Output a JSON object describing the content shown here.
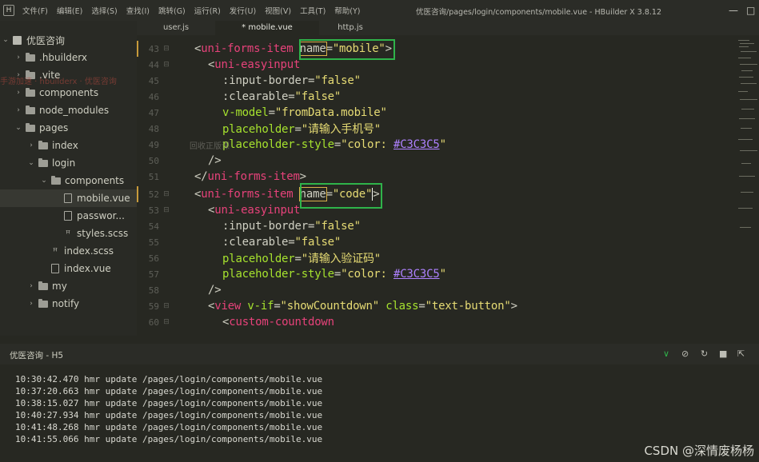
{
  "window": {
    "title": "优医咨询/pages/login/components/mobile.vue - HBuilder X 3.8.12",
    "logo": "H",
    "controls": {
      "minimize": "—",
      "maximize": "□"
    }
  },
  "menu": [
    "文件(F)",
    "编辑(E)",
    "选择(S)",
    "查找(I)",
    "跳转(G)",
    "运行(R)",
    "发行(U)",
    "视图(V)",
    "工具(T)",
    "帮助(Y)"
  ],
  "tabs": [
    {
      "label": "user.js"
    },
    {
      "label": "* mobile.vue",
      "active": true
    },
    {
      "label": "http.js"
    }
  ],
  "sidebar": {
    "project": "优医咨询",
    "watermark": "手游加速 · hbuilderx · 优医咨询",
    "items": [
      {
        "label": ".hbuilderx"
      },
      {
        "label": ".vite"
      },
      {
        "label": "components"
      },
      {
        "label": "node_modules"
      },
      {
        "label": "pages"
      },
      {
        "label": "index"
      },
      {
        "label": "login"
      },
      {
        "label": "components"
      },
      {
        "label": "mobile.vue",
        "selected": true
      },
      {
        "label": "passwor..."
      },
      {
        "label": "styles.scss"
      },
      {
        "label": "index.scss"
      },
      {
        "label": "index.vue"
      },
      {
        "label": "my"
      },
      {
        "label": "notify"
      }
    ],
    "tool_icons": [
      "files-icon",
      "binoculars-icon",
      "search-icon",
      "git-icon",
      "plugin-icon"
    ]
  },
  "editor": {
    "watermark": "回收正版课",
    "line_numbers": [
      "43",
      "44",
      "45",
      "46",
      "47",
      "48",
      "49",
      "50",
      "51",
      "52",
      "53",
      "54",
      "55",
      "56",
      "57",
      "58",
      "59",
      "60"
    ],
    "tokens": {
      "l43_open": "<",
      "l43_tag": "uni-forms-item",
      "l43_attr": "name",
      "l43_eq": "=",
      "l43_val": "\"mobile\"",
      "l43_close": ">",
      "l44_open": "<",
      "l44_tag": "uni-easyinput",
      "l45_attr": ":input-border",
      "l45_eq": "=",
      "l45_val": "\"false\"",
      "l46_attr": ":clearable",
      "l46_eq": "=",
      "l46_val": "\"false\"",
      "l47_attr": "v-model",
      "l47_eq": "=",
      "l47_val": "\"fromData.mobile\"",
      "l48_attr": "placeholder",
      "l48_eq": "=",
      "l48_val": "\"请输入手机号\"",
      "l49_attr": "placeholder-style",
      "l49_eq": "=",
      "l49_q1": "\"color: ",
      "l49_color": "#C3C3C5",
      "l49_q2": "\"",
      "l50_text": "/>",
      "l51_open": "</",
      "l51_tag": "uni-forms-item",
      "l51_close": ">",
      "l52_open": "<",
      "l52_tag": "uni-forms-item",
      "l52_attr": "name",
      "l52_eq": "=",
      "l52_val": "\"code\"",
      "l52_close": ">",
      "l53_open": "<",
      "l53_tag": "uni-easyinput",
      "l54_attr": ":input-border",
      "l54_eq": "=",
      "l54_val": "\"false\"",
      "l55_attr": ":clearable",
      "l55_eq": "=",
      "l55_val": "\"false\"",
      "l56_attr": "placeholder",
      "l56_eq": "=",
      "l56_val": "\"请输入验证码\"",
      "l57_attr": "placeholder-style",
      "l57_eq": "=",
      "l57_q1": "\"color: ",
      "l57_color": "#C3C3C5",
      "l57_q2": "\"",
      "l58_text": "/>",
      "l59_open": "<",
      "l59_tag": "view",
      "l59_attr1": "v-if",
      "l59_eq1": "=",
      "l59_val1": "\"showCountdown\"",
      "l59_attr2": "class",
      "l59_eq2": "=",
      "l59_val2": "\"text-button\"",
      "l59_close": ">",
      "l60_open": "<",
      "l60_tag": "custom-countdown"
    }
  },
  "console": {
    "title": "优医咨询 - H5",
    "icons": [
      "collapse-icon",
      "clear-icon",
      "restart-icon",
      "stop-icon",
      "export-icon"
    ],
    "logs": [
      "10:30:42.470 hmr update /pages/login/components/mobile.vue",
      "10:37:20.663 hmr update /pages/login/components/mobile.vue",
      "10:38:15.027 hmr update /pages/login/components/mobile.vue",
      "10:40:27.934 hmr update /pages/login/components/mobile.vue",
      "10:41:48.268 hmr update /pages/login/components/mobile.vue",
      "10:41:55.066 hmr update /pages/login/components/mobile.vue"
    ]
  },
  "footer": {
    "csdn": "CSDN @深情废杨杨"
  },
  "colors": {
    "highlight_box": "#2fb34a",
    "tag": "#e6427a",
    "string": "#e6db74",
    "directive": "#a6e22e",
    "color_literal": "#ae81ff"
  }
}
